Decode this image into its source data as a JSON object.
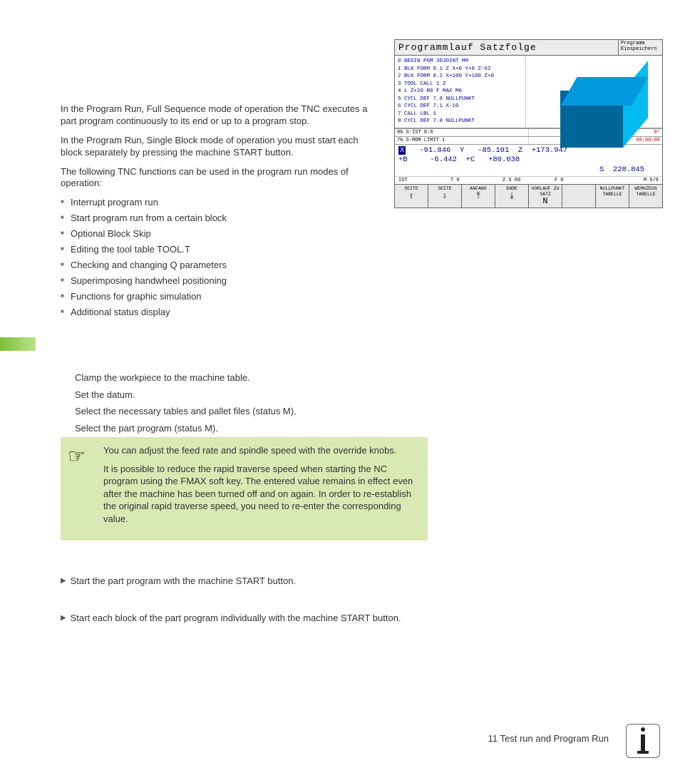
{
  "para1": "In the Program Run, Full Sequence mode of operation the TNC executes a part program continuously to its end or up to a program stop.",
  "para2": "In the Program Run, Single Block mode of operation you must start each block separately by pressing the machine START button.",
  "para3": "The following TNC functions can be used in the program run modes of operation:",
  "bullets": [
    "Interrupt program run",
    "Start program run from a certain block",
    "Optional Block Skip",
    "Editing the tool table TOOL.T",
    "Checking and changing Q parameters",
    "Superimposing handwheel positioning",
    "Functions for graphic simulation",
    "Additional status display"
  ],
  "steps": [
    "Clamp the workpiece to the machine table.",
    "Set the datum.",
    "Select the necessary tables and pallet files (status M).",
    "Select the part program (status M)."
  ],
  "note": {
    "p1": "You can adjust the feed rate and spindle speed with the override knobs.",
    "p2": "It is possible to reduce the rapid traverse speed when starting the NC program using the FMAX soft key. The entered value remains in effect even after the machine has been turned off and on again. In order to re-establish the original rapid traverse speed, you need to re-enter the corresponding value."
  },
  "action1": "Start the part program with the machine START button.",
  "action2": "Start each block of the part program individually with the machine START button.",
  "footer": "11 Test run and Program Run",
  "screen": {
    "title": "Programmlauf Satzfolge",
    "side_title": "Programm\nEinspeichern",
    "prog": [
      "0  BEGIN PGM 3DJOINT MM",
      "1  BLK FORM 0.1 Z X+0 Y+0 Z-62",
      "2  BLK FORM 0.2 X+100 Y+100 Z+0",
      "3  TOOL CALL 1 Z",
      "4  L Z+20 R0 F MAX M6",
      "5  CYCL DEF 7.0 NULLPUNKT",
      "6  CYCL DEF 7.1 X-10",
      "7  CALL LBL 1",
      "8  CYCL DEF 7.0 NULLPUNKT"
    ],
    "status_left": "0% S-IST 8:8",
    "status_left2": "7% S-MOM LIMIT 1",
    "status_right1": "0°",
    "status_right2": "00:00:00",
    "coords_line1_x": "X",
    "coords_line1_xv": "-91.846",
    "coords_line1_y": "Y",
    "coords_line1_yv": "-85.101",
    "coords_line1_z": "Z",
    "coords_line1_zv": "+173.947",
    "coords_line2_b": "+B",
    "coords_line2_bv": "-6.442",
    "coords_line2_c": "+C",
    "coords_line2_cv": "+80.038",
    "coords_line3_s": "S",
    "coords_line3_sv": "228.845",
    "smallrow": {
      "a": "IST",
      "b": "T 0",
      "c": "Z S 60",
      "d": "F 0",
      "e": "M 5/9"
    },
    "softkeys": [
      {
        "l": "SEITE",
        "s": "⇧"
      },
      {
        "l": "SEITE",
        "s": "⇩"
      },
      {
        "l": "ANFANG",
        "s": "⤒"
      },
      {
        "l": "ENDE",
        "s": "⤓"
      },
      {
        "l": "VORLAUF ZU SATZ",
        "s": "N"
      },
      {
        "l": "",
        "s": ""
      },
      {
        "l": "NULLPUNKT TABELLE",
        "s": ""
      },
      {
        "l": "WERKZEUG TABELLE",
        "s": ""
      }
    ]
  }
}
